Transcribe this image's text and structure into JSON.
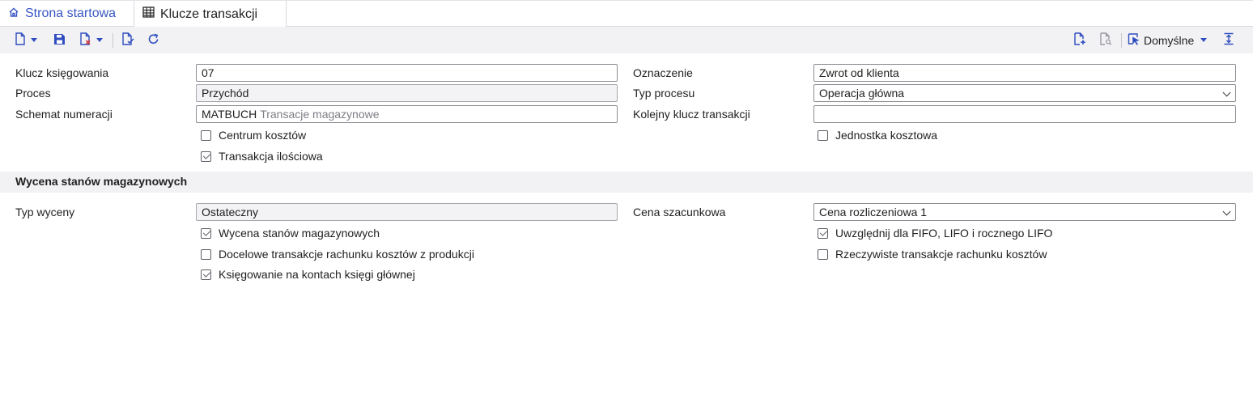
{
  "tabs": {
    "home": "Strona startowa",
    "active": "Klucze transakcji"
  },
  "toolbar": {
    "view_label": "Domyślne"
  },
  "form": {
    "klucz_label": "Klucz księgowania",
    "klucz_value": "07",
    "proces_label": "Proces",
    "proces_value": "Przychód",
    "schemat_label": "Schemat numeracji",
    "schemat_code": "MATBUCH",
    "schemat_desc": "Transacje magazynowe",
    "centrum_label": "Centrum kosztów",
    "centrum_checked": false,
    "ilosciowa_label": "Transakcja ilościowa",
    "ilosciowa_checked": true,
    "oznaczenie_label": "Oznaczenie",
    "oznaczenie_value": "Zwrot od klienta",
    "typ_procesu_label": "Typ procesu",
    "typ_procesu_value": "Operacja główna",
    "kolejny_label": "Kolejny klucz transakcji",
    "kolejny_value": "",
    "jednostka_label": "Jednostka kosztowa",
    "jednostka_checked": false
  },
  "wycena": {
    "title": "Wycena stanów magazynowych",
    "typ_wyceny_label": "Typ wyceny",
    "typ_wyceny_value": "Ostateczny",
    "cena_label": "Cena szacunkowa",
    "cena_value": "Cena rozliczeniowa 1",
    "chk_wycena_label": "Wycena stanów magazynowych",
    "chk_wycena_checked": true,
    "chk_docelowe_label": "Docelowe transakcje rachunku kosztów z produkcji",
    "chk_docelowe_checked": false,
    "chk_ksiegowanie_label": "Księgowanie na kontach księgi głównej",
    "chk_ksiegowanie_checked": true,
    "chk_fifo_label": "Uwzględnij dla FIFO, LIFO i rocznego LIFO",
    "chk_fifo_checked": true,
    "chk_rzeczywiste_label": "Rzeczywiste transakcje rachunku kosztów",
    "chk_rzeczywiste_checked": false
  },
  "icons": {
    "home": "home-icon",
    "grid": "table-grid-icon",
    "new": "new-document-icon",
    "save": "save-icon",
    "delete": "delete-document-icon",
    "validate": "validate-document-icon",
    "refresh": "refresh-icon",
    "add_page": "add-page-icon",
    "search_page": "search-page-icon",
    "view": "view-select-icon",
    "collapse": "collapse-icon"
  },
  "colors": {
    "accent": "#2f4dbf",
    "toolbar_bg": "#f2f2f4",
    "section_bg": "#f2f2f4"
  }
}
